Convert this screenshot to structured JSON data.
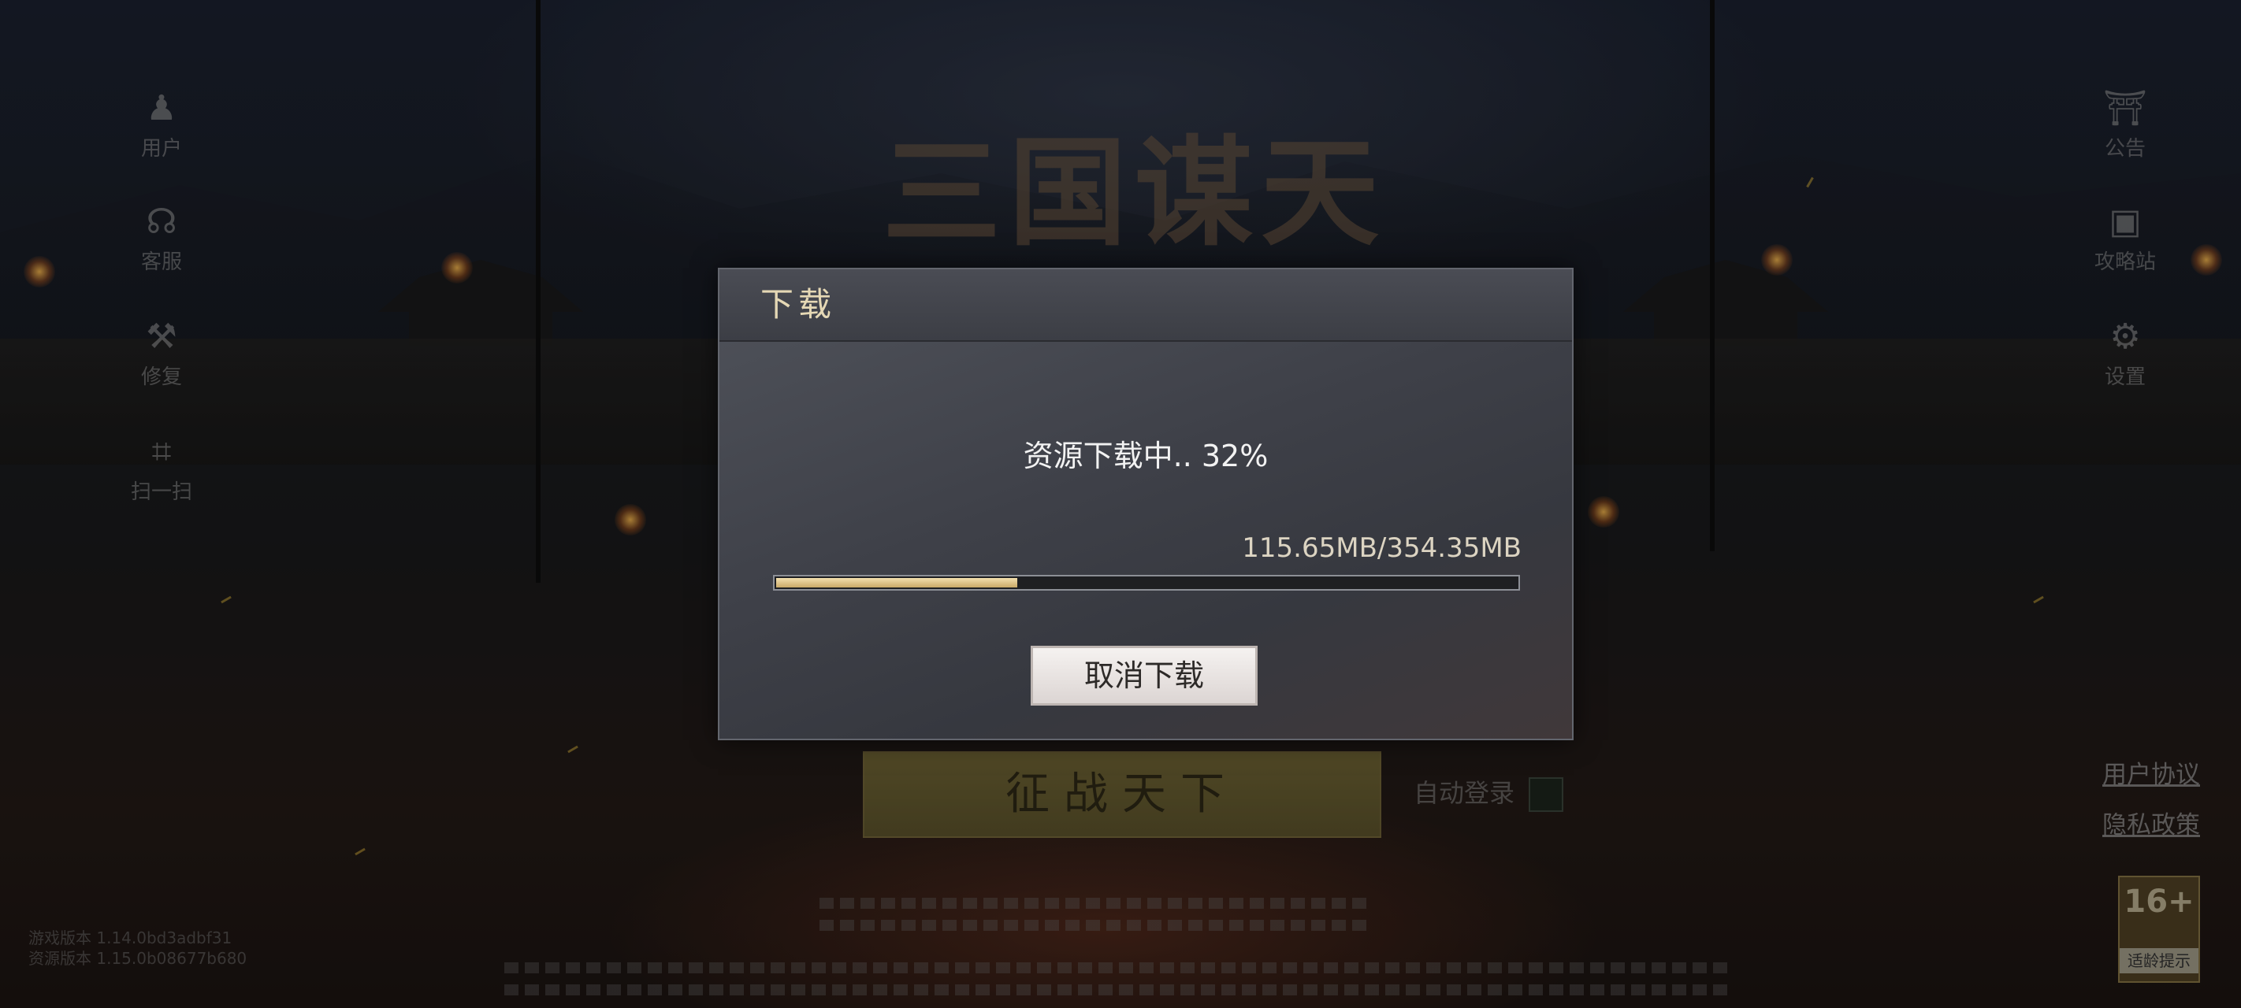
{
  "background": {
    "game_title": "三国谋天"
  },
  "side_left": [
    {
      "label": "用户",
      "icon": "user-icon"
    },
    {
      "label": "客服",
      "icon": "headset-icon"
    },
    {
      "label": "修复",
      "icon": "wrench-icon"
    },
    {
      "label": "扫一扫",
      "icon": "scan-icon"
    }
  ],
  "side_right": [
    {
      "label": "公告",
      "icon": "notice-board-icon"
    },
    {
      "label": "攻略站",
      "icon": "guide-icon"
    },
    {
      "label": "设置",
      "icon": "gear-icon"
    }
  ],
  "login": {
    "main_button": "征战天下",
    "auto_login_label": "自动登录"
  },
  "links": {
    "user_agreement": "用户协议",
    "privacy_policy": "隐私政策"
  },
  "age_rating": {
    "rating": "16+",
    "caption": "适龄提示"
  },
  "version": {
    "game_version": "游戏版本 1.14.0bd3adbf31",
    "resource_version": "资源版本 1.15.0b08677b680"
  },
  "dialog": {
    "title": "下载",
    "status_text": "资源下载中.. 32%",
    "size_text": "115.65MB/354.35MB",
    "progress": 0.326,
    "cancel_button": "取消下载"
  },
  "colors": {
    "accent_gold": "#e5d8b5",
    "progress_fill": "#c9a968",
    "dialog_bg": "#3e4048"
  }
}
